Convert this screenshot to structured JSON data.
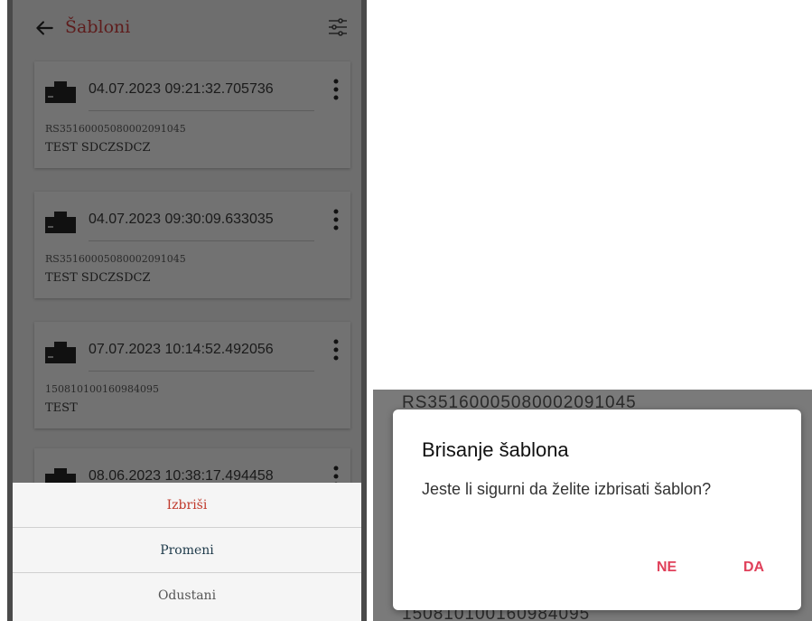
{
  "appbar": {
    "title": "Šabloni"
  },
  "templates": [
    {
      "date": "04.07.2023 09:21:32.705736",
      "account": "RS35160005080002091045",
      "name": "TEST SDCZSDCZ"
    },
    {
      "date": "04.07.2023 09:30:09.633035",
      "account": "RS35160005080002091045",
      "name": "TEST SDCZSDCZ"
    },
    {
      "date": "07.07.2023 10:14:52.492056",
      "account": "150810100160984095",
      "name": "TEST"
    },
    {
      "date": "08.06.2023 10:38:17.494458"
    }
  ],
  "sheet": {
    "delete_label": "Izbriši",
    "change_label": "Promeni",
    "cancel_label": "Odustani"
  },
  "background": {
    "top_text": "RS35160005080002091045",
    "bottom_text": "150810100160984095"
  },
  "dialog": {
    "title": "Brisanje šablona",
    "message": "Jeste li sigurni da želite izbrisati šablon?",
    "no_label": "NE",
    "yes_label": "DA"
  },
  "colors": {
    "accent": "#e0405a",
    "title": "#5e1c1c",
    "delete": "#c0392b"
  }
}
